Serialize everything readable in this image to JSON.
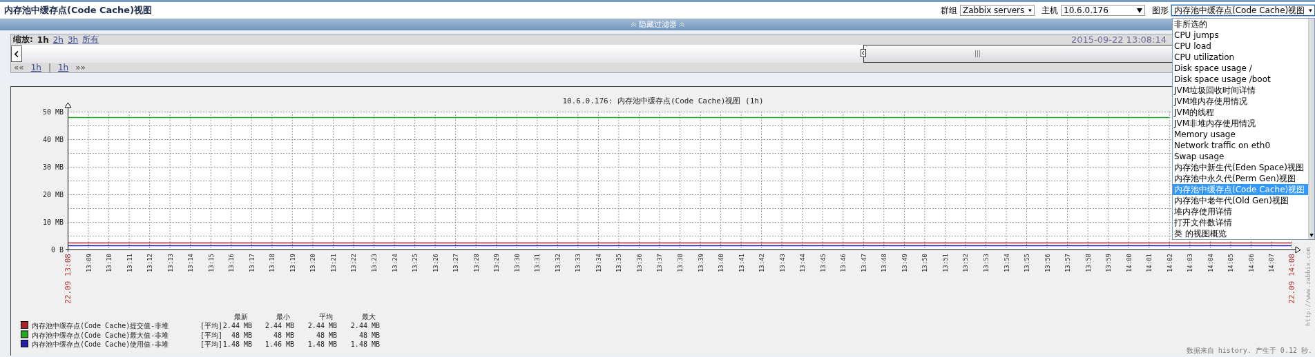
{
  "page_title": "内存池中缓存点(Code Cache)视图",
  "filters": [
    {
      "label": "群组",
      "value": "Zabbix servers",
      "expanded": false
    },
    {
      "label": "主机",
      "value": "10.6.0.176",
      "expanded": false
    },
    {
      "label": "图形",
      "value": "内存池中缓存点(Code Cache)视图",
      "expanded": true,
      "options": [
        {
          "label": "非所选的",
          "selected": false
        },
        {
          "label": "CPU jumps",
          "selected": false
        },
        {
          "label": "CPU load",
          "selected": false
        },
        {
          "label": "CPU utilization",
          "selected": false
        },
        {
          "label": "Disk space usage /",
          "selected": false
        },
        {
          "label": "Disk space usage /boot",
          "selected": false
        },
        {
          "label": "JVM垃圾回收时间详情",
          "selected": false
        },
        {
          "label": "JVM堆内存使用情况",
          "selected": false
        },
        {
          "label": "JVM的线程",
          "selected": false
        },
        {
          "label": "JVM非堆内存使用情况",
          "selected": false
        },
        {
          "label": "Memory usage",
          "selected": false
        },
        {
          "label": "Network traffic on eth0",
          "selected": false
        },
        {
          "label": "Swap usage",
          "selected": false
        },
        {
          "label": "内存池中新生代(Eden Space)视图",
          "selected": false
        },
        {
          "label": "内存池中永久代(Perm Gen)视图",
          "selected": false
        },
        {
          "label": "内存池中缓存点(Code Cache)视图",
          "selected": true
        },
        {
          "label": "内存池中老年代(Old Gen)视图",
          "selected": false
        },
        {
          "label": "堆内存使用详情",
          "selected": false
        },
        {
          "label": "打开文件数详情",
          "selected": false
        },
        {
          "label": "类 的视图概览",
          "selected": false
        }
      ]
    }
  ],
  "filter_bar": {
    "label": "隐藏过滤器"
  },
  "timeline": {
    "zoom_label": "缩放:",
    "zoom_options": [
      {
        "label": "1h",
        "selected": true
      },
      {
        "label": "2h",
        "selected": false
      },
      {
        "label": "3h",
        "selected": false
      },
      {
        "label": "所有",
        "selected": false
      }
    ],
    "date": "2015-09-22 13:08:14",
    "period_slider": {
      "level": 0.34
    },
    "nav": [
      {
        "kind": "arrow",
        "label": "««"
      },
      {
        "kind": "link",
        "label": "1h"
      },
      {
        "kind": "separator",
        "label": "|"
      },
      {
        "kind": "link",
        "label": "1h"
      },
      {
        "kind": "arrow",
        "label": "»»"
      }
    ]
  },
  "graph": {
    "chart_data": {
      "type": "line",
      "title": "10.6.0.176: 内存池中缓存点(Code Cache)视图 (1h)",
      "grid": true,
      "categories": [
        "22.09 13:08",
        "13:09",
        "13:10",
        "13:11",
        "13:12",
        "13:13",
        "13:14",
        "13:15",
        "13:16",
        "13:17",
        "13:18",
        "13:19",
        "13:20",
        "13:21",
        "13:22",
        "13:23",
        "13:24",
        "13:25",
        "13:26",
        "13:27",
        "13:28",
        "13:29",
        "13:30",
        "13:31",
        "13:32",
        "13:33",
        "13:34",
        "13:35",
        "13:36",
        "13:37",
        "13:38",
        "13:39",
        "13:40",
        "13:41",
        "13:42",
        "13:43",
        "13:44",
        "13:45",
        "13:46",
        "13:47",
        "13:48",
        "13:49",
        "13:50",
        "13:51",
        "13:52",
        "13:53",
        "13:54",
        "13:55",
        "13:56",
        "13:57",
        "13:58",
        "13:59",
        "14:00",
        "14:01",
        "14:02",
        "14:03",
        "14:04",
        "14:05",
        "14:06",
        "14:07",
        "22.09 14:08"
      ],
      "legend": "bottom",
      "ylim": [
        0,
        50
      ],
      "yticks": [
        {
          "value": 0,
          "label": "0 B"
        },
        {
          "value": 10,
          "label": "10 MB"
        },
        {
          "value": 20,
          "label": "20 MB"
        },
        {
          "value": 30,
          "label": "30 MB"
        },
        {
          "value": 40,
          "label": "40 MB"
        },
        {
          "value": 50,
          "label": "50 MB"
        }
      ],
      "series": [
        {
          "name": "内存池中缓存点(Code Cache)提交值-非堆",
          "color": "#aa2222",
          "values": [
            2.4,
            2.4,
            2.4,
            2.4,
            2.4,
            2.4,
            2.4,
            2.4,
            2.4,
            2.4,
            2.4,
            2.4,
            2.4,
            2.4,
            2.4,
            2.4,
            2.4,
            2.4,
            2.4,
            2.4,
            2.4,
            2.4,
            2.4,
            2.4,
            2.4,
            2.4,
            2.4,
            2.4,
            2.4,
            2.4,
            2.4,
            2.4,
            2.4,
            2.4,
            2.4,
            2.4,
            2.4,
            2.4,
            2.4,
            2.4,
            2.4,
            2.4,
            2.4,
            2.4,
            2.4,
            2.4,
            2.4,
            2.4,
            2.4,
            2.4,
            2.4,
            2.4,
            2.4,
            2.4,
            2.4,
            2.4,
            2.4,
            2.4,
            2.4,
            2.4,
            2.4
          ]
        },
        {
          "name": "内存池中缓存点(Code Cache)最大值-非堆",
          "color": "#22aa22",
          "values": [
            48,
            48,
            48,
            48,
            48,
            48,
            48,
            48,
            48,
            48,
            48,
            48,
            48,
            48,
            48,
            48,
            48,
            48,
            48,
            48,
            48,
            48,
            48,
            48,
            48,
            48,
            48,
            48,
            48,
            48,
            48,
            48,
            48,
            48,
            48,
            48,
            48,
            48,
            48,
            48,
            48,
            48,
            48,
            48,
            48,
            48,
            48,
            48,
            48,
            48,
            48,
            48,
            48,
            48,
            48,
            null,
            null,
            null,
            null,
            null,
            null
          ]
        },
        {
          "name": "内存池中缓存点(Code Cache)使用值-非堆",
          "color": "#2222aa",
          "values": [
            1.5,
            1.5,
            1.5,
            1.5,
            1.5,
            1.5,
            1.5,
            1.5,
            1.5,
            1.5,
            1.5,
            1.5,
            1.5,
            1.5,
            1.5,
            1.5,
            1.5,
            1.5,
            1.5,
            1.5,
            1.5,
            1.5,
            1.5,
            1.5,
            1.5,
            1.5,
            1.5,
            1.5,
            1.5,
            1.5,
            1.5,
            1.5,
            1.5,
            1.5,
            1.5,
            1.5,
            1.5,
            1.5,
            1.5,
            1.5,
            1.5,
            1.5,
            1.5,
            1.5,
            1.5,
            1.5,
            1.5,
            1.5,
            1.5,
            1.5,
            1.5,
            1.5,
            1.5,
            1.5,
            1.5,
            1.5,
            1.5,
            1.5,
            1.5,
            1.5,
            1.5
          ]
        }
      ]
    },
    "legend": {
      "columns": [
        "最新",
        "最小",
        "平均",
        "最大"
      ],
      "rows": [
        {
          "function": "[平均]",
          "values": [
            "2.44 MB",
            "2.44 MB",
            "2.44 MB",
            "2.44 MB"
          ]
        },
        {
          "function": "[平均]",
          "values": [
            "48 MB",
            "48 MB",
            "48 MB",
            "48 MB"
          ]
        },
        {
          "function": "[平均]",
          "values": [
            "1.48 MB",
            "1.46 MB",
            "1.48 MB",
            "1.48 MB"
          ]
        }
      ]
    },
    "side_url": "http://www.zabbix.com",
    "footer": "数据来自 history. 产生于 0.12 秒."
  }
}
